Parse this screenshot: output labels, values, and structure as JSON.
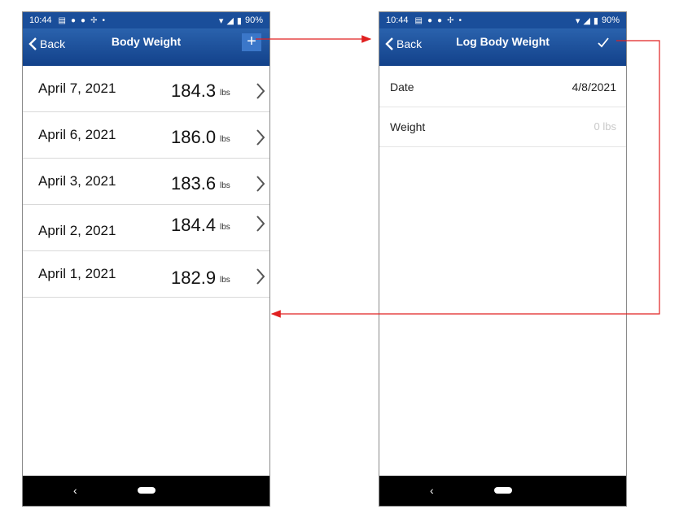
{
  "left_screen": {
    "status": {
      "time": "10:44",
      "battery": "90%"
    },
    "nav": {
      "back": "Back",
      "title": "Body Weight",
      "add": "+"
    },
    "entries": [
      {
        "date": "April 7, 2021",
        "weight": "184.3",
        "unit": "lbs"
      },
      {
        "date": "April 6, 2021",
        "weight": "186.0",
        "unit": "lbs"
      },
      {
        "date": "April 3, 2021",
        "weight": "183.6",
        "unit": "lbs"
      },
      {
        "date": "April 2, 2021",
        "weight": "184.4",
        "unit": "lbs"
      },
      {
        "date": "April 1, 2021",
        "weight": "182.9",
        "unit": "lbs"
      }
    ]
  },
  "right_screen": {
    "status": {
      "time": "10:44",
      "battery": "90%"
    },
    "nav": {
      "back": "Back",
      "title": "Log Body Weight"
    },
    "form": {
      "date_label": "Date",
      "date_value": "4/8/2021",
      "weight_label": "Weight",
      "weight_placeholder": "0 lbs"
    }
  },
  "colors": {
    "navbar": "#1a4e9a",
    "arrow": "#e02020"
  }
}
